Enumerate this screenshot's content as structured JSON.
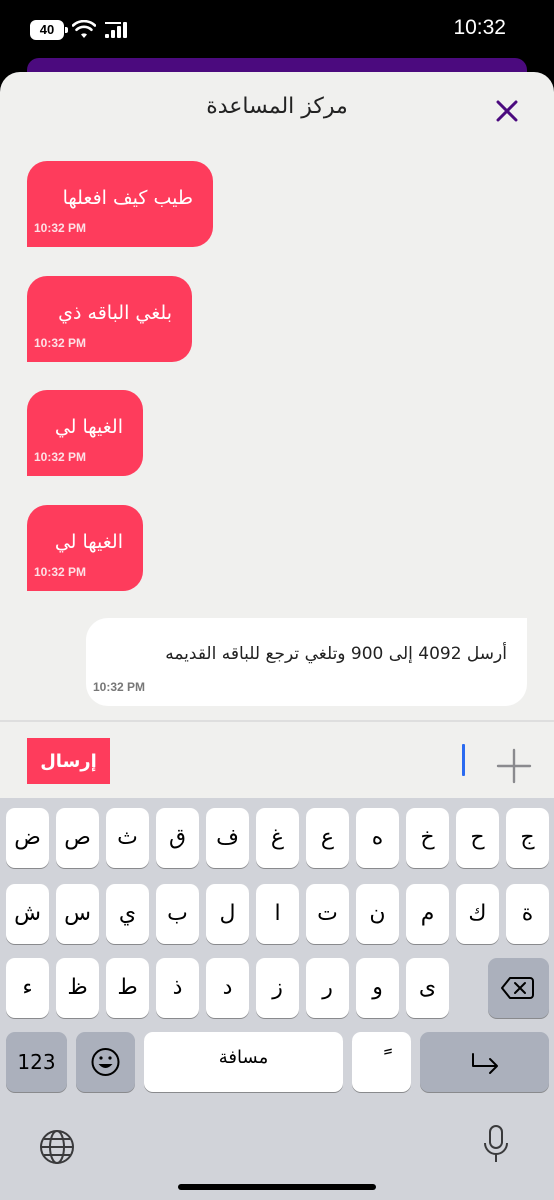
{
  "status_bar": {
    "time": "10:32",
    "battery": "40"
  },
  "sheet": {
    "title": "مركز المساعدة"
  },
  "messages": [
    {
      "text": "طيب كيف افعلها",
      "time": "10:32 PM"
    },
    {
      "text": "بلغي الباقه ذي",
      "time": "10:32 PM"
    },
    {
      "text": "الغيها لي",
      "time": "10:32 PM"
    },
    {
      "text": "الغيها لي",
      "time": "10:32 PM"
    },
    {
      "text": "أرسل 4092 إلى 900 وتلغي ترجع للباقه القديمه",
      "time": "10:32 PM"
    }
  ],
  "composer": {
    "send_label": "إرسال",
    "input_value": ""
  },
  "keyboard": {
    "row1": [
      "ج",
      "ح",
      "خ",
      "ه",
      "ع",
      "غ",
      "ف",
      "ق",
      "ث",
      "ص",
      "ض"
    ],
    "row2": [
      "ة",
      "ك",
      "م",
      "ن",
      "ت",
      "ا",
      "ل",
      "ب",
      "ي",
      "س",
      "ش"
    ],
    "row3": [
      "ى",
      "و",
      "ر",
      "ز",
      "د",
      "ذ",
      "ط",
      "ظ",
      "ء"
    ],
    "numbers_label": "123",
    "space_label": "مسافة",
    "tanween_label": "ً"
  },
  "colors": {
    "accent": "#fe3c5c",
    "header_purple": "#4b0a7e",
    "caret": "#2a6af0"
  },
  "icons": [
    "wifi-icon",
    "cellular-icon",
    "battery-icon",
    "close-icon",
    "plus-icon",
    "backspace-icon",
    "emoji-icon",
    "return-icon",
    "globe-icon",
    "microphone-icon"
  ]
}
